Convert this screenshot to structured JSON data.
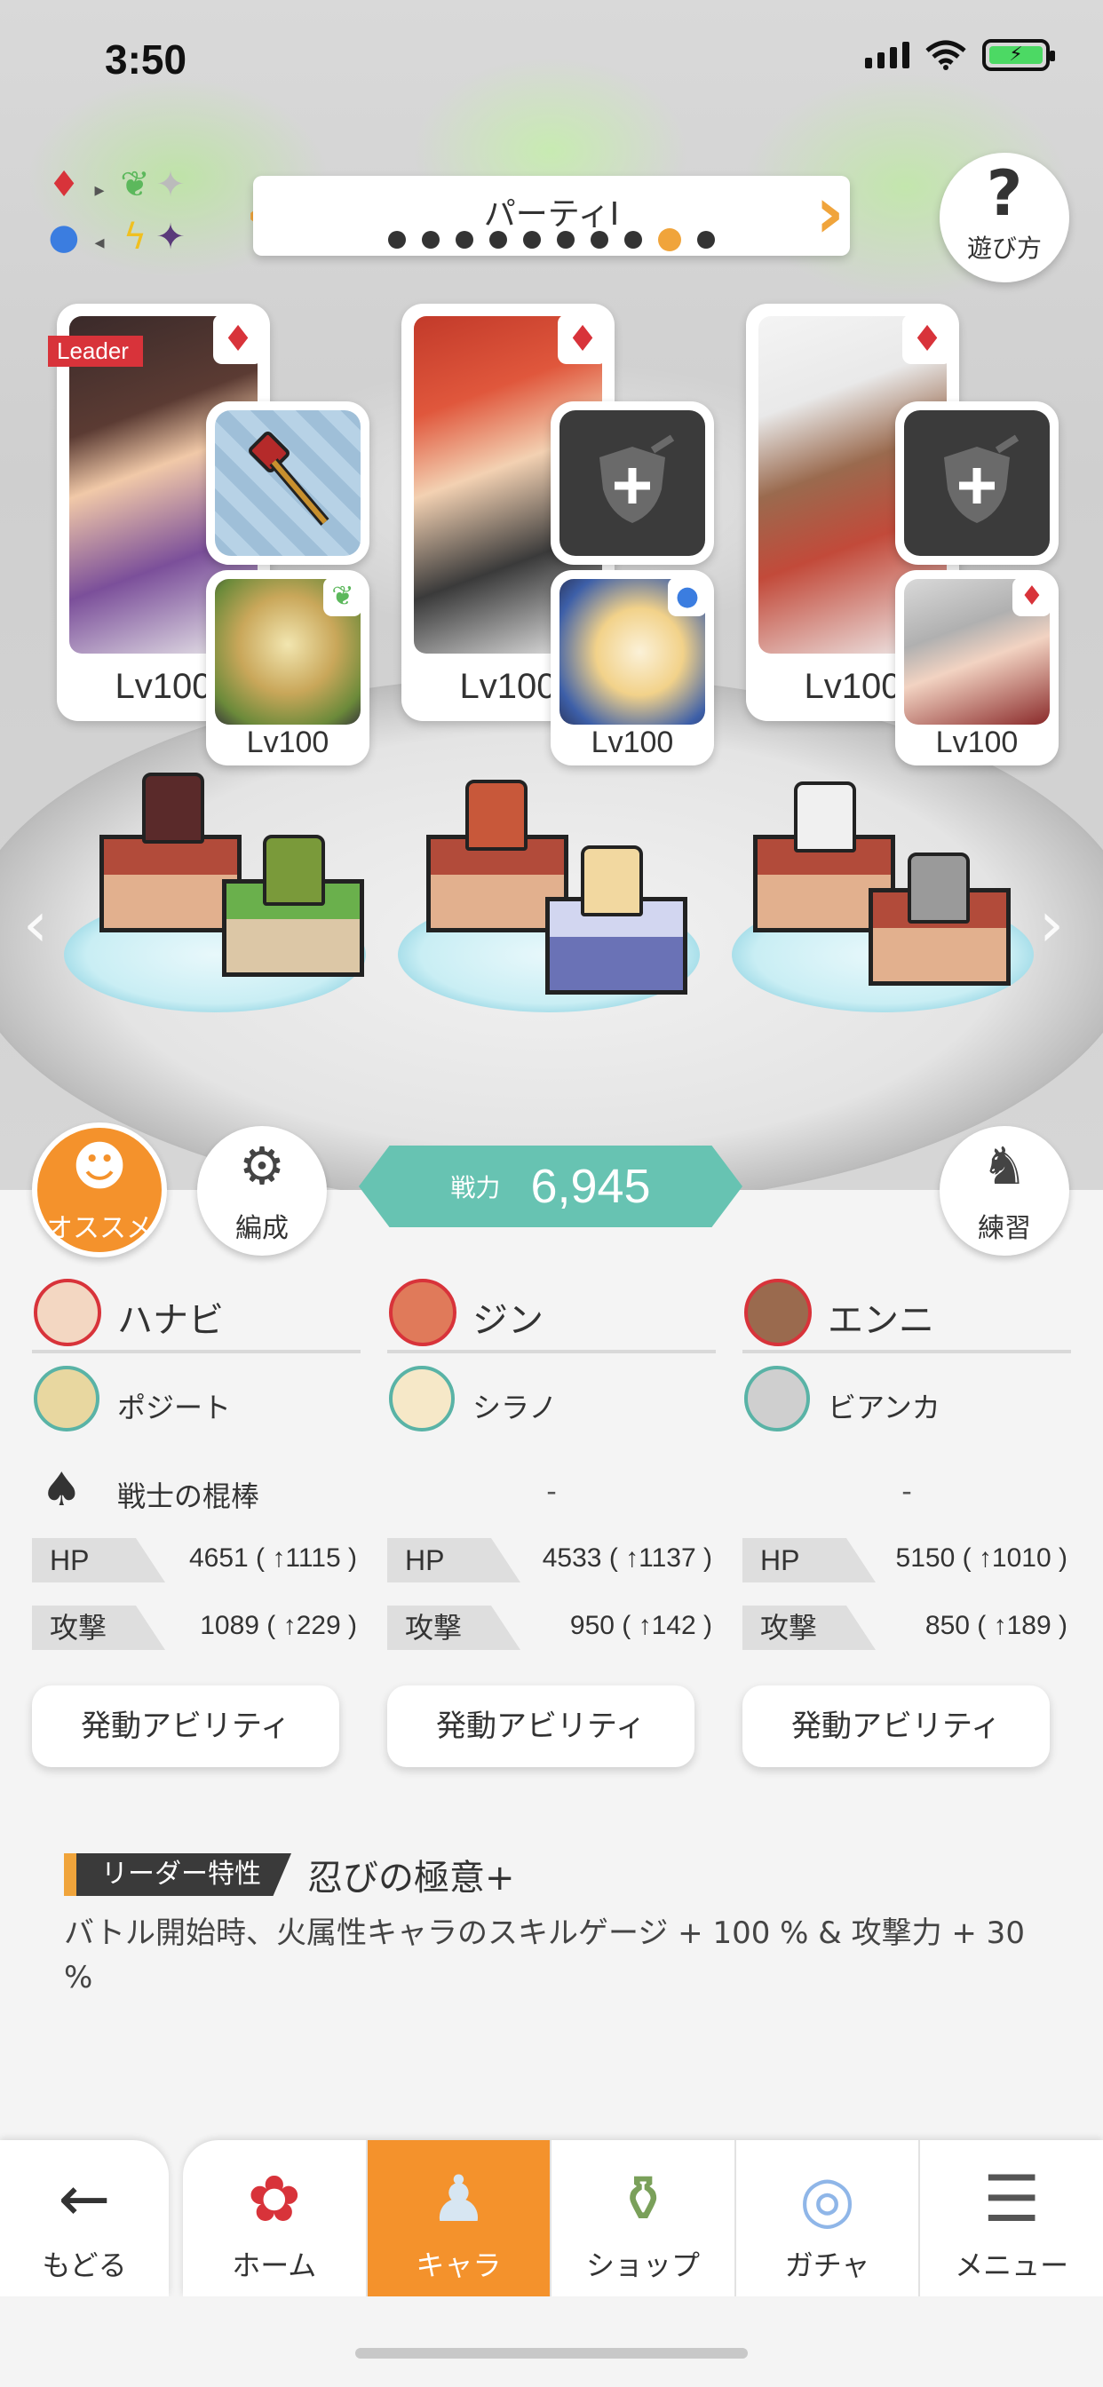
{
  "status": {
    "time": "3:50"
  },
  "party": {
    "title": "パーティI",
    "page_count": 10,
    "active_page": 9
  },
  "help": {
    "icon": "?",
    "label": "遊び方"
  },
  "leader_tag": "Leader",
  "units": [
    {
      "level": "Lv100",
      "partner_level": "Lv100",
      "equip": "weapon",
      "partner_attr": "wind"
    },
    {
      "level": "Lv100",
      "partner_level": "Lv100",
      "equip": "empty",
      "partner_attr": "water"
    },
    {
      "level": "Lv100",
      "partner_level": "Lv100",
      "equip": "empty",
      "partner_attr": "fire"
    }
  ],
  "actions": {
    "recommend_label": "オススメ",
    "formation_label": "編成",
    "practice_label": "練習",
    "power_label": "戦力",
    "power_value": "6,945"
  },
  "columns": [
    {
      "name": "ハナビ",
      "partner": "ポジート",
      "equipment": "戦士の棍棒",
      "hp_label": "HP",
      "hp": "4651 ( ↑1115 )",
      "atk_label": "攻撃",
      "atk": "1089 ( ↑229 )",
      "ability": "発動アビリティ"
    },
    {
      "name": "ジン",
      "partner": "シラノ",
      "equipment": "-",
      "hp_label": "HP",
      "hp": "4533 ( ↑1137 )",
      "atk_label": "攻撃",
      "atk": "950 ( ↑142 )",
      "ability": "発動アビリティ"
    },
    {
      "name": "エンニ",
      "partner": "ビアンカ",
      "equipment": "-",
      "hp_label": "HP",
      "hp": "5150 ( ↑1010 )",
      "atk_label": "攻撃",
      "atk": "850 ( ↑189 )",
      "ability": "発動アビリティ"
    }
  ],
  "leader_skill": {
    "tag": "リーダー特性",
    "title": "忍びの極意+",
    "description": "バトル開始時、火属性キャラのスキルゲージ + 100 % & 攻撃力 + 30 %"
  },
  "nav": {
    "back_label": "もどる",
    "items": [
      {
        "label": "ホーム",
        "icon": "home-icon"
      },
      {
        "label": "キャラ",
        "icon": "character-icon"
      },
      {
        "label": "ショップ",
        "icon": "shop-icon"
      },
      {
        "label": "ガチャ",
        "icon": "gacha-icon"
      },
      {
        "label": "メニュー",
        "icon": "menu-icon"
      }
    ],
    "active_index": 1
  },
  "colors": {
    "accent": "#f4922c",
    "power": "#67c3b2",
    "fire": "#d8333a"
  }
}
